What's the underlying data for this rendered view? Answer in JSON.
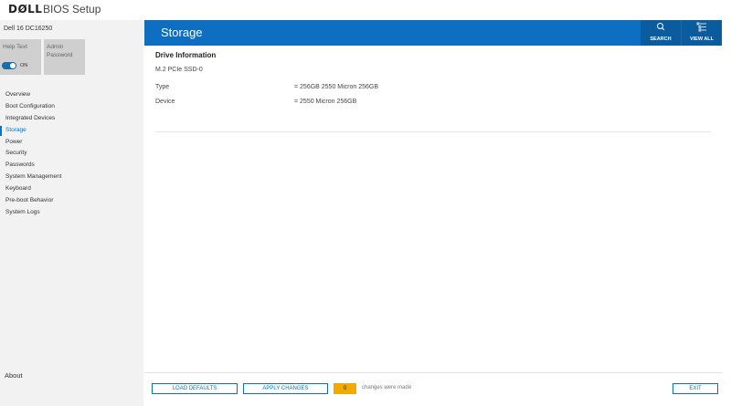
{
  "header": {
    "logo": "DØLL",
    "app_title": "BIOS Setup"
  },
  "sidebar": {
    "model": "Dell 16 DC16250",
    "help_text_tile": {
      "label": "Help Text",
      "toggle_state": "ON"
    },
    "admin_password_tile": {
      "label": "Admin Password"
    },
    "items": [
      {
        "label": "Overview",
        "active": false
      },
      {
        "label": "Boot Configuration",
        "active": false
      },
      {
        "label": "Integrated Devices",
        "active": false
      },
      {
        "label": "Storage",
        "active": true
      },
      {
        "label": "Power",
        "active": false
      },
      {
        "label": "Security",
        "active": false
      },
      {
        "label": "Passwords",
        "active": false
      },
      {
        "label": "System Management",
        "active": false
      },
      {
        "label": "Keyboard",
        "active": false
      },
      {
        "label": "Pre-boot Behavior",
        "active": false
      },
      {
        "label": "System Logs",
        "active": false
      }
    ],
    "about_label": "About"
  },
  "main": {
    "title": "Storage",
    "search_button": {
      "label": "SEARCH",
      "icon": "search-icon"
    },
    "view_all_button": {
      "label": "VIEW ALL",
      "icon": "view-all-icon"
    },
    "section_title": "Drive Information",
    "drive_name": "M.2 PCIe SSD-0",
    "rows": [
      {
        "key": "Type",
        "value": "= 256GB 2550 Micron 256GB"
      },
      {
        "key": "Device",
        "value": "= 2550 Micron 256GB"
      }
    ]
  },
  "footer": {
    "load_defaults_label": "LOAD DEFAULTS",
    "apply_changes_label": "APPLY CHANGES",
    "changes_count": "0",
    "changes_text": "changes were made",
    "exit_label": "EXIT"
  },
  "colors": {
    "accent": "#0d6ec2",
    "header_button": "#0a5c9f",
    "badge": "#f2a900",
    "sidebar_bg": "#f2f2f2"
  }
}
